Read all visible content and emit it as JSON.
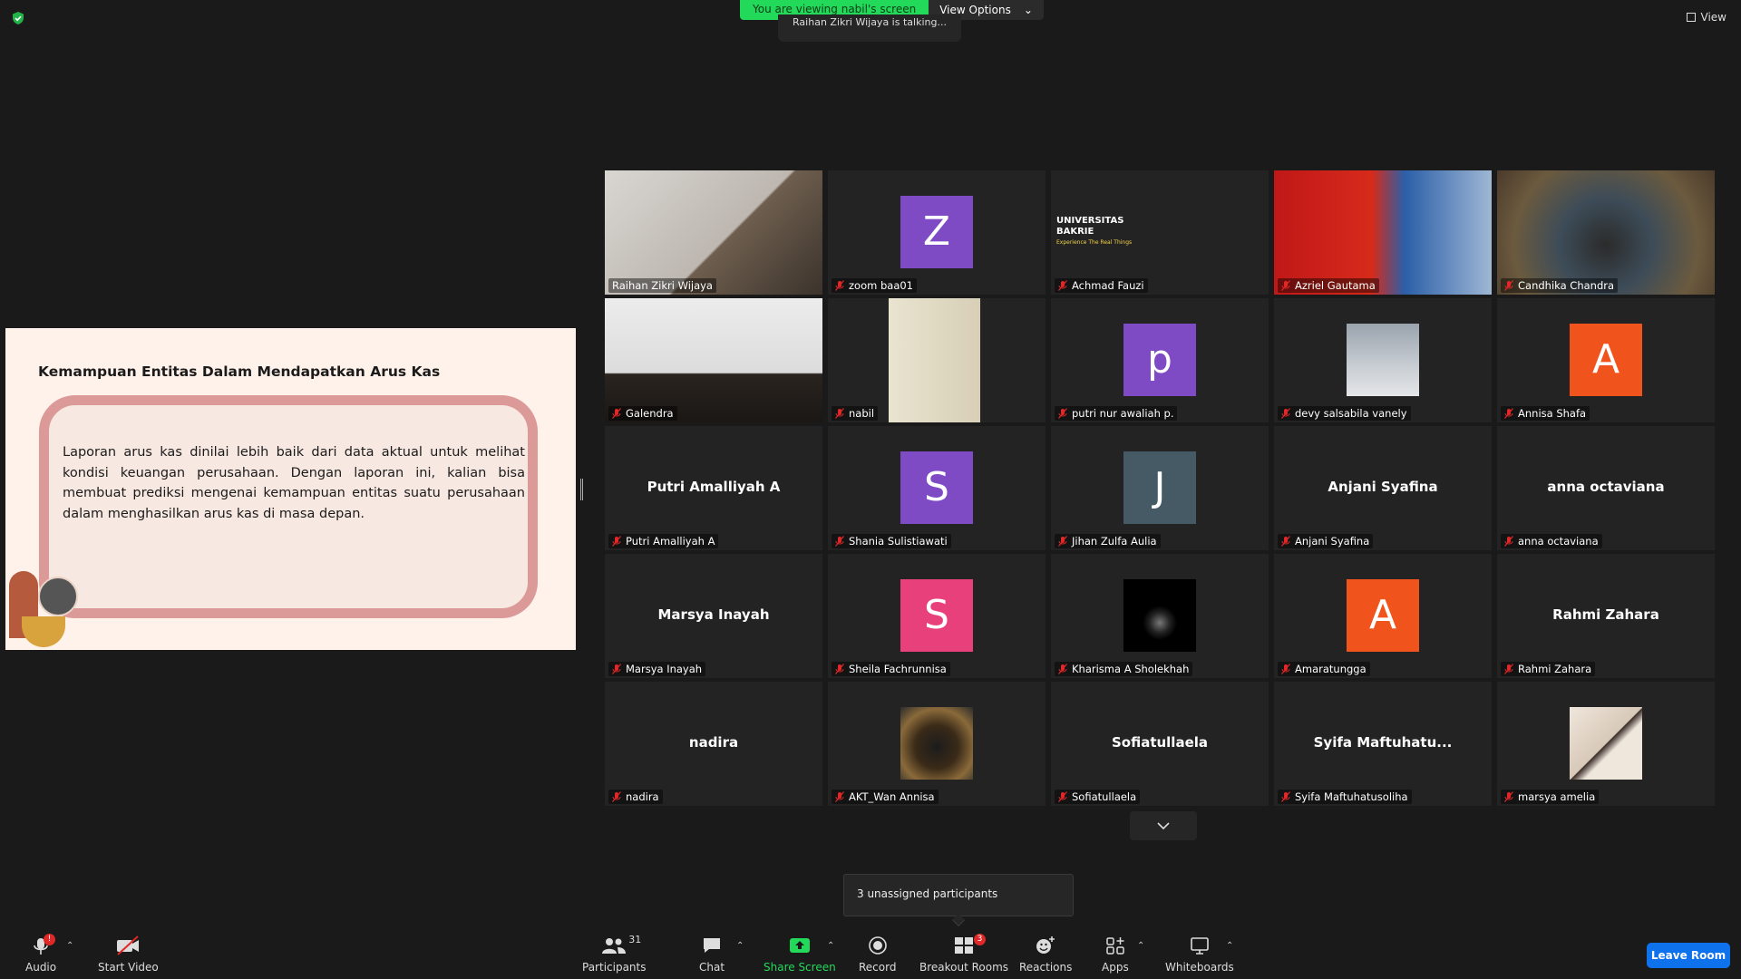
{
  "top": {
    "viewing_text": "You are viewing nabil's screen",
    "view_options_label": "View Options",
    "talking_text": "Raihan Zikri Wijaya is talking...",
    "view_label": "View"
  },
  "slide": {
    "title": "Kemampuan Entitas Dalam Mendapatkan Arus Kas",
    "body": "Laporan arus kas dinilai lebih baik dari data aktual untuk melihat kondisi keuangan perusahaan. Dengan laporan ini, kalian bisa membuat prediksi mengenai kemampuan entitas suatu perusahaan dalam menghasilkan arus kas di masa depan."
  },
  "participants": [
    {
      "name": "Raihan Zikri Wijaya",
      "type": "video",
      "active": true
    },
    {
      "name": "zoom baa01",
      "type": "avatar",
      "initial": "Z",
      "color": "#7e4bc4"
    },
    {
      "name": "Achmad Fauzi",
      "type": "video",
      "banner_line1": "UNIVERSITAS",
      "banner_line2": "BAKRIE",
      "banner_tagline": "Experience The Real Things"
    },
    {
      "name": "Azriel Gautama",
      "type": "video"
    },
    {
      "name": "Candhika Chandra",
      "type": "video"
    },
    {
      "name": "Galendra",
      "type": "video"
    },
    {
      "name": "nabil",
      "type": "video"
    },
    {
      "name": "putri nur awaliah p.",
      "type": "avatar",
      "initial": "p",
      "color": "#7e4bc4"
    },
    {
      "name": "devy salsabila vanely",
      "type": "photo"
    },
    {
      "name": "Annisa Shafa",
      "type": "avatar",
      "initial": "A",
      "color": "#f0531c"
    },
    {
      "name": "Putri Amalliyah A",
      "type": "name",
      "display": "Putri Amalliyah A"
    },
    {
      "name": "Shania Sulistiawati",
      "type": "avatar",
      "initial": "S",
      "color": "#7e4bc4"
    },
    {
      "name": "Jihan Zulfa Aulia",
      "type": "avatar",
      "initial": "J",
      "color": "#455a64"
    },
    {
      "name": "Anjani Syafina",
      "type": "name",
      "display": "Anjani Syafina"
    },
    {
      "name": "anna octaviana",
      "type": "name",
      "display": "anna octaviana"
    },
    {
      "name": "Marsya Inayah",
      "type": "name",
      "display": "Marsya Inayah"
    },
    {
      "name": "Sheila Fachrunnisa",
      "type": "avatar",
      "initial": "S",
      "color": "#e8407a"
    },
    {
      "name": "Kharisma A Sholekhah",
      "type": "photo"
    },
    {
      "name": "Amaratungga",
      "type": "avatar",
      "initial": "A",
      "color": "#f0531c"
    },
    {
      "name": "Rahmi Zahara",
      "type": "name",
      "display": "Rahmi Zahara"
    },
    {
      "name": "nadira",
      "type": "name",
      "display": "nadira"
    },
    {
      "name": "AKT_Wan Annisa",
      "type": "photo"
    },
    {
      "name": "Sofiatullaela",
      "type": "name",
      "display": "Sofiatullaela"
    },
    {
      "name": "Syifa Maftuhatusoliha",
      "type": "name",
      "display": "Syifa  Maftuhatu..."
    },
    {
      "name": "marsya amelia",
      "type": "photo"
    }
  ],
  "toast_text": "3 unassigned participants",
  "toolbar": {
    "audio_label": "Audio",
    "audio_badge": "!",
    "video_label": "Start Video",
    "participants_label": "Participants",
    "participants_count": "31",
    "chat_label": "Chat",
    "share_label": "Share Screen",
    "record_label": "Record",
    "breakout_label": "Breakout Rooms",
    "breakout_badge": "3",
    "reactions_label": "Reactions",
    "apps_label": "Apps",
    "whiteboards_label": "Whiteboards",
    "leave_label": "Leave Room"
  },
  "colors": {
    "accent": "#0e72ed",
    "share_green": "#23d959",
    "active_border": "#e8f06a"
  }
}
